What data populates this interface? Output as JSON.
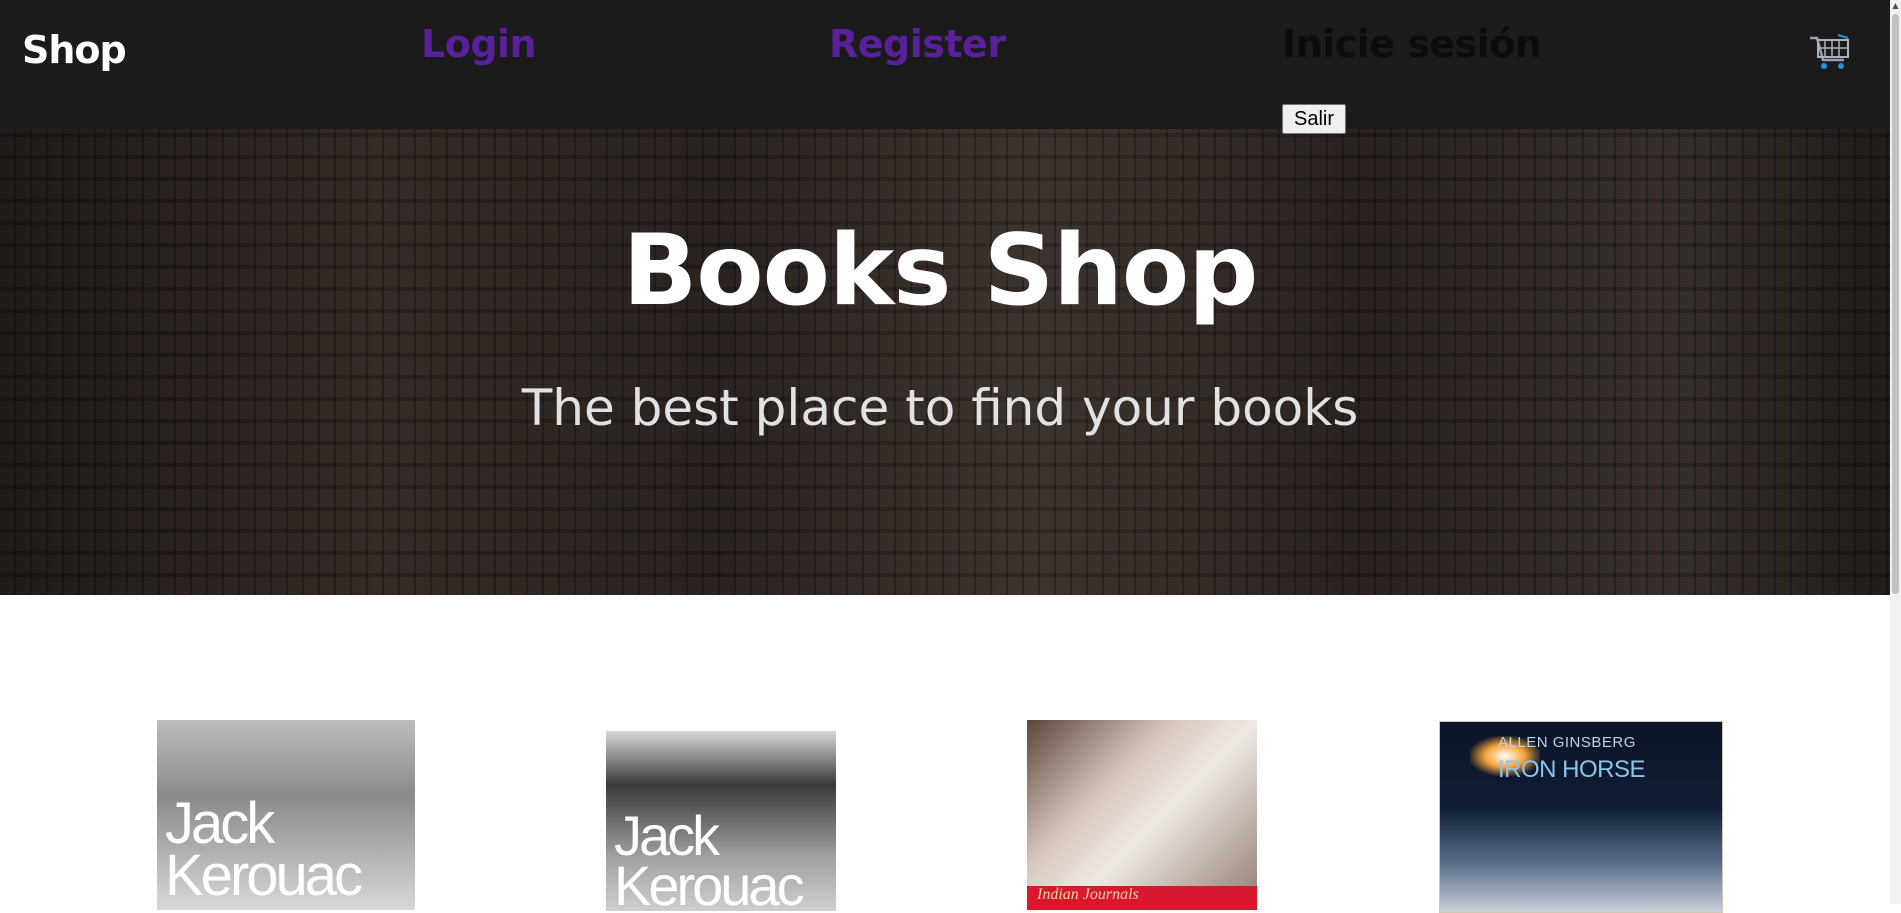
{
  "header": {
    "brand": "Shop",
    "nav": {
      "login": "Login",
      "register": "Register"
    },
    "user_label": "Inicie sesión",
    "logout_button": "Salir",
    "cart_icon": "shopping-cart-icon"
  },
  "hero": {
    "title": "Books Shop",
    "subtitle": "The best place to find your books"
  },
  "products": [
    {
      "cover_text": "Jack Kerouac"
    },
    {
      "cover_text": "Jack Kerouac"
    },
    {
      "cover_text": "Indian Journals"
    },
    {
      "cover_author": "ALLEN GINSBERG",
      "cover_text": "IRON HORSE"
    }
  ],
  "colors": {
    "header_bg": "#1b1b1b",
    "nav_link": "#5a1f9a",
    "page_bg": "#ffffff"
  }
}
